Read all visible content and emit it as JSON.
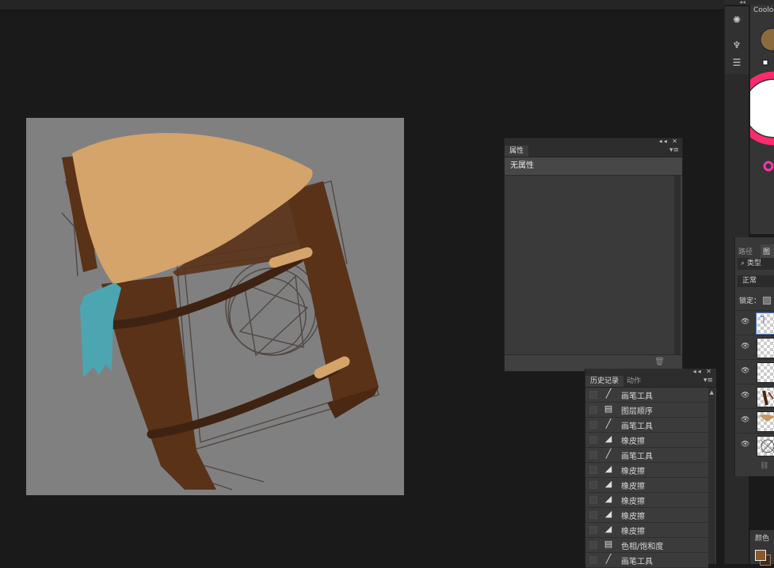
{
  "properties_panel": {
    "tab": "属性",
    "content": "无属性",
    "collapse_glyph": "◂◂",
    "close_glyph": "✕",
    "menu_glyph": "▾≡",
    "trash_icon": "trash-icon"
  },
  "history_panel": {
    "tabs": [
      "历史记录",
      "动作"
    ],
    "active_tab": 0,
    "items": [
      {
        "label": "画笔工具",
        "icon": "brush-icon",
        "glyph": "╱"
      },
      {
        "label": "图层顺序",
        "icon": "layer-doc-icon",
        "glyph": "▤"
      },
      {
        "label": "画笔工具",
        "icon": "brush-icon",
        "glyph": "╱"
      },
      {
        "label": "橡皮擦",
        "icon": "eraser-icon",
        "glyph": "◢"
      },
      {
        "label": "画笔工具",
        "icon": "brush-icon",
        "glyph": "╱"
      },
      {
        "label": "橡皮擦",
        "icon": "eraser-icon",
        "glyph": "◢"
      },
      {
        "label": "橡皮擦",
        "icon": "eraser-icon",
        "glyph": "◢"
      },
      {
        "label": "橡皮擦",
        "icon": "eraser-icon",
        "glyph": "◢"
      },
      {
        "label": "橡皮擦",
        "icon": "eraser-icon",
        "glyph": "◢"
      },
      {
        "label": "橡皮擦",
        "icon": "eraser-icon",
        "glyph": "◢"
      },
      {
        "label": "色相/饱和度",
        "icon": "layer-doc-icon",
        "glyph": "▤"
      },
      {
        "label": "画笔工具",
        "icon": "brush-icon",
        "glyph": "╱"
      }
    ]
  },
  "color_panel": {
    "tab": "Coolo",
    "foreground_color": "#8b6a3e"
  },
  "layers_panel": {
    "tabs": [
      "路径",
      "图层"
    ],
    "filter_label": "⌕ 类型",
    "blend_mode": "正常",
    "lock_label": "锁定：",
    "layer_count": 6,
    "selected_index": 0
  },
  "swatches_panel": {
    "tab": "颜色",
    "fg": "#8a5a2c",
    "bg": "#4a2a12"
  },
  "canvas": {
    "background": "#808080",
    "colors": {
      "tan": "#d4a46a",
      "brown": "#5a3218",
      "dark_brown": "#3e2312",
      "teal": "#4ba6b2",
      "sketch": "#4a3e3a"
    }
  },
  "icons": {
    "toolbar_top": "gear-sun-icon",
    "toolbar_brush": "brush-settings-icon",
    "toolbar_adjust": "sliders-icon",
    "eye": "eye-icon",
    "link": "link-icon"
  }
}
